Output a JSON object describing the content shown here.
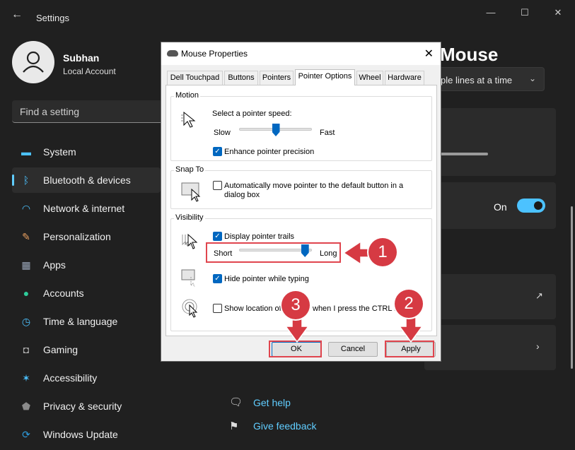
{
  "window": {
    "back_icon": "back-arrow-icon",
    "title": "Settings",
    "minimize": "—",
    "maximize": "☐",
    "close": "✕"
  },
  "user": {
    "name": "Subhan",
    "type": "Local Account"
  },
  "search": {
    "placeholder": "Find a setting"
  },
  "nav": [
    {
      "label": "System",
      "icon": "monitor-icon",
      "color": "#4cc2ff"
    },
    {
      "label": "Bluetooth & devices",
      "icon": "bluetooth-icon",
      "color": "#4cc2ff",
      "selected": true
    },
    {
      "label": "Network & internet",
      "icon": "wifi-icon",
      "color": "#4cc2ff"
    },
    {
      "label": "Personalization",
      "icon": "brush-icon",
      "color": "#e8a060"
    },
    {
      "label": "Apps",
      "icon": "apps-icon",
      "color": "#9aa6b8"
    },
    {
      "label": "Accounts",
      "icon": "person-icon",
      "color": "#2ecc9a"
    },
    {
      "label": "Time & language",
      "icon": "clock-icon",
      "color": "#4cc2ff"
    },
    {
      "label": "Gaming",
      "icon": "gamepad-icon",
      "color": "#aaaaaa"
    },
    {
      "label": "Accessibility",
      "icon": "accessibility-icon",
      "color": "#4cc2ff"
    },
    {
      "label": "Privacy & security",
      "icon": "shield-icon",
      "color": "#8a8a8a"
    },
    {
      "label": "Windows Update",
      "icon": "update-icon",
      "color": "#2e9bdc"
    }
  ],
  "main": {
    "heading_fragment": "Mouse",
    "dropdown_fragment": "ple lines at a time",
    "toggle_label": "On",
    "help_link": "Get help",
    "feedback_link": "Give feedback"
  },
  "dialog": {
    "title": "Mouse Properties",
    "close": "✕",
    "tabs": [
      "Dell Touchpad",
      "Buttons",
      "Pointers",
      "Pointer Options",
      "Wheel",
      "Hardware"
    ],
    "active_tab": "Pointer Options",
    "motion": {
      "label": "Motion",
      "speed_label": "Select a pointer speed:",
      "slow": "Slow",
      "fast": "Fast",
      "speed_fraction": 0.5,
      "precision_label": "Enhance pointer precision",
      "precision_checked": true
    },
    "snap": {
      "label": "Snap To",
      "text": "Automatically move pointer to the default button in a dialog box",
      "checked": false
    },
    "visibility": {
      "label": "Visibility",
      "trails_label": "Display pointer trails",
      "trails_checked": true,
      "short": "Short",
      "long": "Long",
      "trails_fraction": 0.9,
      "hide_label": "Hide pointer while typing",
      "hide_checked": true,
      "show_location_label": "Show location of p",
      "show_location_tail": "when I press the CTRL key",
      "show_location_checked": false
    },
    "buttons": {
      "ok": "OK",
      "cancel": "Cancel",
      "apply": "Apply"
    }
  },
  "annotations": {
    "one": "1",
    "two": "2",
    "three": "3"
  },
  "colors": {
    "accent": "#60cdff",
    "annotation_red": "#d63a43",
    "checkbox_blue": "#0067c0"
  }
}
